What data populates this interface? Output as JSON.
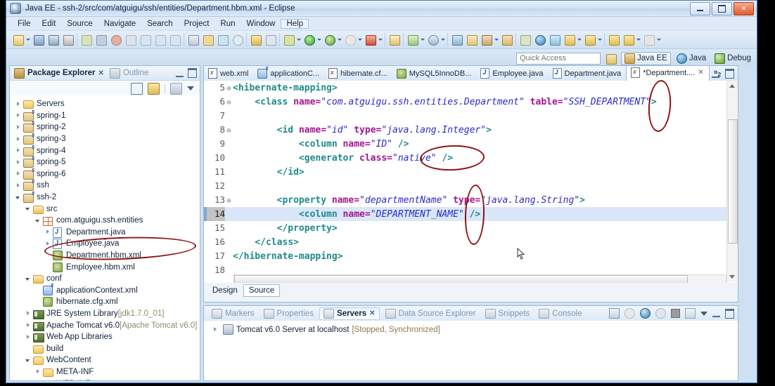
{
  "window": {
    "title": "Java EE - ssh-2/src/com/atguigu/ssh/entities/Department.hbm.xml - Eclipse",
    "app_icon": "eclipse-icon",
    "minimize": "minimize-button",
    "maximize": "restore-button",
    "close": "×"
  },
  "menu": [
    "File",
    "Edit",
    "Source",
    "Navigate",
    "Search",
    "Project",
    "Run",
    "Window",
    "Help"
  ],
  "toolbar": {
    "groups": [
      [
        "new-wizard-icon",
        "dropdown",
        "save-icon",
        "save-all-icon",
        "print-icon"
      ],
      [
        "run-skip-icon",
        "pause-icon",
        "terminate-icon",
        "disconnect-icon",
        "step-into-icon",
        "step-over-icon",
        "step-return-icon"
      ],
      [
        "toggle-breakpoint-icon",
        "debug-bug-icon",
        "open-type-icon",
        "search-icon"
      ],
      [
        "link-icon"
      ],
      [
        "external-tools-icon",
        "dropdown",
        "run-icon",
        "dropdown",
        "debug-icon",
        "dropdown",
        "coverage-icon",
        "dropdown",
        "run-as-server-icon",
        "dropdown"
      ],
      [
        "new-java-project-icon"
      ],
      [
        "new-package-icon",
        "dropdown",
        "new-class-icon",
        "dropdown"
      ],
      [
        "open-perspective-icon",
        "open-resource-icon",
        "pin-icon",
        "dropdown",
        "annotation-icon"
      ],
      [
        "restore-icon",
        "globe-icon",
        "network-icon",
        "previous-anno-icon",
        "dropdown",
        "next-anno-icon",
        "dropdown"
      ],
      [
        "back-icon",
        "forward-icon",
        "dropdown",
        "next-icon",
        "dropdown"
      ]
    ]
  },
  "quick_access": {
    "placeholder": "Quick Access",
    "value": "",
    "open_perspective_icon": "open-perspective-icon",
    "perspectives": [
      {
        "label": "Java EE",
        "icon": "java-ee-icon",
        "active": true
      },
      {
        "label": "Java",
        "icon": "java-icon",
        "active": false
      },
      {
        "label": "Debug",
        "icon": "debug-icon",
        "active": false
      }
    ]
  },
  "package_explorer": {
    "tabs": [
      {
        "label": "Package Explorer",
        "icon": "package-explorer-icon",
        "selected": true,
        "close": "✕"
      },
      {
        "label": "Outline",
        "icon": "outline-icon",
        "selected": false
      }
    ],
    "view_buttons": [
      "minimize-view-button",
      "maximize-view-button"
    ],
    "toolbar_icons": [
      "collapse-all-icon",
      "link-with-editor-icon",
      "view-menu-filter-icon",
      "view-menu-icon"
    ],
    "tree": [
      {
        "label": "Servers",
        "indent": 0,
        "twisty": "collapsed",
        "icon": "folder-icon"
      },
      {
        "label": "spring-1",
        "indent": 0,
        "twisty": "collapsed",
        "icon": "project-icon"
      },
      {
        "label": "spring-2",
        "indent": 0,
        "twisty": "collapsed",
        "icon": "project-icon"
      },
      {
        "label": "spring-3",
        "indent": 0,
        "twisty": "collapsed",
        "icon": "project-icon"
      },
      {
        "label": "spring-4",
        "indent": 0,
        "twisty": "collapsed",
        "icon": "project-icon"
      },
      {
        "label": "spring-5",
        "indent": 0,
        "twisty": "collapsed",
        "icon": "project-icon"
      },
      {
        "label": "spring-6",
        "indent": 0,
        "twisty": "collapsed",
        "icon": "project-icon"
      },
      {
        "label": "ssh",
        "indent": 0,
        "twisty": "collapsed",
        "icon": "project-icon"
      },
      {
        "label": "ssh-2",
        "indent": 0,
        "twisty": "expanded",
        "icon": "project-icon"
      },
      {
        "label": "src",
        "indent": 1,
        "twisty": "expanded",
        "icon": "source-folder-icon"
      },
      {
        "label": "com.atguigu.ssh.entities",
        "indent": 2,
        "twisty": "expanded",
        "icon": "package-icon"
      },
      {
        "label": "Department.java",
        "indent": 3,
        "twisty": "collapsed",
        "icon": "java-file-icon"
      },
      {
        "label": "Employee.java",
        "indent": 3,
        "twisty": "collapsed",
        "icon": "java-file-icon"
      },
      {
        "label": "Department.hbm.xml",
        "indent": 3,
        "twisty": "none",
        "icon": "hbm-file-icon"
      },
      {
        "label": "Employee.hbm.xml",
        "indent": 3,
        "twisty": "none",
        "icon": "hbm-file-icon"
      },
      {
        "label": "conf",
        "indent": 1,
        "twisty": "expanded",
        "icon": "source-folder-icon"
      },
      {
        "label": "applicationContext.xml",
        "indent": 2,
        "twisty": "none",
        "icon": "spring-file-icon"
      },
      {
        "label": "hibernate.cfg.xml",
        "indent": 2,
        "twisty": "none",
        "icon": "hbm-file-icon"
      },
      {
        "label": "JRE System Library",
        "suffix": "[jdk1.7.0_01]",
        "indent": 1,
        "twisty": "collapsed",
        "icon": "library-icon"
      },
      {
        "label": "Apache Tomcat v6.0",
        "suffix": "[Apache Tomcat v6.0]",
        "indent": 1,
        "twisty": "collapsed",
        "icon": "library-icon"
      },
      {
        "label": "Web App Libraries",
        "indent": 1,
        "twisty": "collapsed",
        "icon": "library-icon"
      },
      {
        "label": "build",
        "indent": 1,
        "twisty": "none",
        "icon": "folder-icon"
      },
      {
        "label": "WebContent",
        "indent": 1,
        "twisty": "expanded",
        "icon": "folder-icon"
      },
      {
        "label": "META-INF",
        "indent": 2,
        "twisty": "collapsed",
        "icon": "folder-icon"
      },
      {
        "label": "WEB-INF",
        "indent": 2,
        "twisty": "collapsed",
        "icon": "folder-icon"
      }
    ]
  },
  "editor": {
    "tabs": [
      {
        "label": "web.xml",
        "icon": "xml-file-icon",
        "active": false
      },
      {
        "label": "applicationC...",
        "icon": "spring-file-icon",
        "active": false
      },
      {
        "label": "hibernate.cf...",
        "icon": "xml-file-icon",
        "active": false
      },
      {
        "label": "MySQL5InnoDB...",
        "icon": "database-icon",
        "active": false
      },
      {
        "label": "Employee.java",
        "icon": "java-file-icon",
        "active": false
      },
      {
        "label": "Department.java",
        "icon": "java-file-icon",
        "active": false
      },
      {
        "label": "*Department....",
        "icon": "xml-file-icon",
        "active": true,
        "close": "✕"
      }
    ],
    "more_tabs": "»",
    "more_tabs_count": "2",
    "view_buttons": [
      "minimize-editor-button",
      "maximize-editor-button"
    ],
    "bottom_tabs": [
      {
        "label": "Design",
        "selected": false
      },
      {
        "label": "Source",
        "selected": true
      }
    ],
    "current_line": 14,
    "lines": [
      {
        "n": "5",
        "fold": "⊖",
        "indent": 0,
        "tokens": [
          {
            "t": "tag",
            "v": "<hibernate-mapping>"
          }
        ]
      },
      {
        "n": "6",
        "fold": "⊖",
        "indent": 4,
        "tokens": [
          {
            "t": "tag",
            "v": "<class"
          },
          {
            "t": "plain",
            "v": " "
          },
          {
            "t": "attr",
            "v": "name="
          },
          {
            "t": "val",
            "v": "\"com.atguigu.ssh.entities.Department\""
          },
          {
            "t": "plain",
            "v": " "
          },
          {
            "t": "attr",
            "v": "table="
          },
          {
            "t": "val",
            "v": "\"SSH_DEPARTMENT\""
          },
          {
            "t": "tag",
            "v": ">"
          }
        ]
      },
      {
        "n": "7",
        "fold": "",
        "indent": 0,
        "tokens": []
      },
      {
        "n": "8",
        "fold": "⊖",
        "indent": 8,
        "tokens": [
          {
            "t": "tag",
            "v": "<id"
          },
          {
            "t": "plain",
            "v": " "
          },
          {
            "t": "attr",
            "v": "name="
          },
          {
            "t": "val",
            "v": "\"id\""
          },
          {
            "t": "plain",
            "v": " "
          },
          {
            "t": "attr",
            "v": "type="
          },
          {
            "t": "val",
            "v": "\"java.lang.Integer\""
          },
          {
            "t": "tag",
            "v": ">"
          }
        ]
      },
      {
        "n": "9",
        "fold": "",
        "indent": 12,
        "tokens": [
          {
            "t": "tag",
            "v": "<column"
          },
          {
            "t": "plain",
            "v": " "
          },
          {
            "t": "attr",
            "v": "name="
          },
          {
            "t": "val",
            "v": "\"ID\""
          },
          {
            "t": "plain",
            "v": " "
          },
          {
            "t": "tag",
            "v": "/>"
          }
        ]
      },
      {
        "n": "10",
        "fold": "",
        "indent": 12,
        "tokens": [
          {
            "t": "tag",
            "v": "<generator"
          },
          {
            "t": "plain",
            "v": " "
          },
          {
            "t": "attr",
            "v": "class="
          },
          {
            "t": "val",
            "v": "\"native\""
          },
          {
            "t": "plain",
            "v": " "
          },
          {
            "t": "tag",
            "v": "/>"
          }
        ]
      },
      {
        "n": "11",
        "fold": "",
        "indent": 8,
        "tokens": [
          {
            "t": "tag",
            "v": "</id>"
          }
        ]
      },
      {
        "n": "12",
        "fold": "",
        "indent": 0,
        "tokens": []
      },
      {
        "n": "13",
        "fold": "⊖",
        "indent": 8,
        "tokens": [
          {
            "t": "tag",
            "v": "<property"
          },
          {
            "t": "plain",
            "v": " "
          },
          {
            "t": "attr",
            "v": "name="
          },
          {
            "t": "val",
            "v": "\"departmentName\""
          },
          {
            "t": "plain",
            "v": " "
          },
          {
            "t": "attr",
            "v": "type="
          },
          {
            "t": "val",
            "v": "\"java.lang.String\""
          },
          {
            "t": "tag",
            "v": ">"
          }
        ]
      },
      {
        "n": "14",
        "fold": "",
        "indent": 12,
        "tokens": [
          {
            "t": "tag",
            "v": "<column"
          },
          {
            "t": "plain",
            "v": " "
          },
          {
            "t": "attr",
            "v": "name="
          },
          {
            "t": "val",
            "v": "\"DEPARTMENT_NAME\""
          },
          {
            "t": "plain",
            "v": " "
          },
          {
            "t": "tag",
            "v": "/>"
          }
        ]
      },
      {
        "n": "15",
        "fold": "",
        "indent": 8,
        "tokens": [
          {
            "t": "tag",
            "v": "</property>"
          }
        ]
      },
      {
        "n": "16",
        "fold": "",
        "indent": 4,
        "tokens": [
          {
            "t": "tag",
            "v": "</class>"
          }
        ]
      },
      {
        "n": "17",
        "fold": "",
        "indent": 0,
        "tokens": [
          {
            "t": "tag",
            "v": "</hibernate-mapping>"
          }
        ]
      },
      {
        "n": "18",
        "fold": "",
        "indent": 0,
        "tokens": []
      }
    ]
  },
  "bottom_panel": {
    "tabs": [
      {
        "label": "Markers",
        "icon": "markers-icon",
        "selected": false
      },
      {
        "label": "Properties",
        "icon": "properties-icon",
        "selected": false
      },
      {
        "label": "Servers",
        "icon": "servers-icon",
        "selected": true,
        "close": "✕"
      },
      {
        "label": "Data Source Explorer",
        "icon": "data-source-explorer-icon",
        "selected": false
      },
      {
        "label": "Snippets",
        "icon": "snippets-icon",
        "selected": false
      },
      {
        "label": "Console",
        "icon": "console-icon",
        "selected": false
      }
    ],
    "view_buttons": [
      "new-server-icon",
      "start-icon",
      "debug-icon",
      "profile-icon",
      "stop-icon",
      "publish-icon",
      "view-menu-icon",
      "minimize-view-button",
      "maximize-view-button"
    ],
    "rows": [
      {
        "label": "Tomcat v6.0 Server at localhost",
        "status": "[Stopped, Synchronized]",
        "twisty": "collapsed",
        "icon": "server-icon"
      }
    ]
  },
  "annotations": {
    "color": "#8e1212",
    "shapes": [
      {
        "name": "ellipse-ssh-department-underscore"
      },
      {
        "name": "ellipse-native-value"
      },
      {
        "name": "ellipse-department-name-underscore"
      },
      {
        "name": "ellipse-department-hbm-xml-file"
      }
    ]
  },
  "cursor": {
    "name": "mouse-pointer"
  }
}
